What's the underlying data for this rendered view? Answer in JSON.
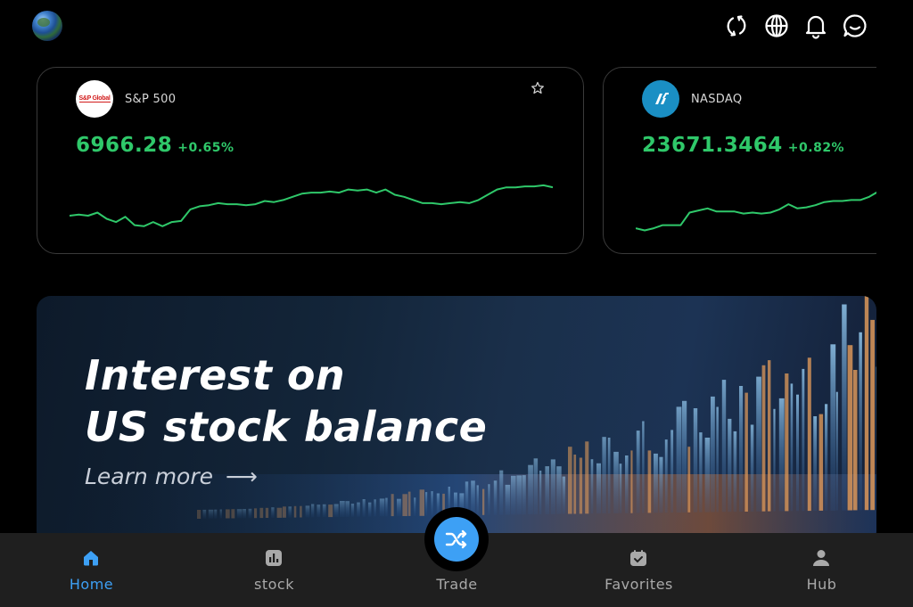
{
  "header": {
    "avatar": "globe-avatar",
    "icons": [
      "refresh-icon",
      "globe-icon",
      "bell-icon",
      "chat-icon"
    ]
  },
  "markets": [
    {
      "name": "S&P 500",
      "logo_text": "S&P Global",
      "price": "6966.28",
      "change": "+0.65%",
      "color": "#2fc86a",
      "favorite": false,
      "sparkline": [
        239,
        238,
        239,
        236,
        242,
        245,
        240,
        248,
        249,
        245,
        249,
        245,
        244,
        233,
        230,
        229,
        227,
        228,
        228,
        229,
        228,
        225,
        226,
        224,
        221,
        218,
        217,
        217,
        216,
        217,
        214,
        215,
        214,
        217,
        214,
        219,
        221,
        224,
        227,
        227,
        228,
        227,
        226,
        227,
        224,
        219,
        214,
        212,
        212,
        211,
        211,
        210,
        212
      ]
    },
    {
      "name": "NASDAQ",
      "logo_text": "N",
      "price": "23671.3464",
      "change": "+0.82%",
      "color": "#2fc86a",
      "favorite": false,
      "sparkline": [
        251,
        253,
        251,
        248,
        248,
        248,
        236,
        234,
        232,
        235,
        235,
        235,
        237,
        236,
        237,
        236,
        233,
        228,
        232,
        231,
        229,
        226,
        225,
        225,
        224,
        224,
        221,
        216
      ]
    }
  ],
  "banner": {
    "title_line1": "Interest on",
    "title_line2": "US stock balance",
    "link": "Learn more",
    "arrow": "⟶"
  },
  "nav": {
    "items": [
      {
        "label": "Home",
        "icon": "home-icon",
        "active": true
      },
      {
        "label": "stock",
        "icon": "stock-chart-icon",
        "active": false
      },
      {
        "label": "Trade",
        "icon": "shuffle-icon",
        "active": false
      },
      {
        "label": "Favorites",
        "icon": "favorites-icon",
        "active": false
      },
      {
        "label": "Hub",
        "icon": "user-icon",
        "active": false
      }
    ],
    "active_color": "#3da0f5"
  }
}
